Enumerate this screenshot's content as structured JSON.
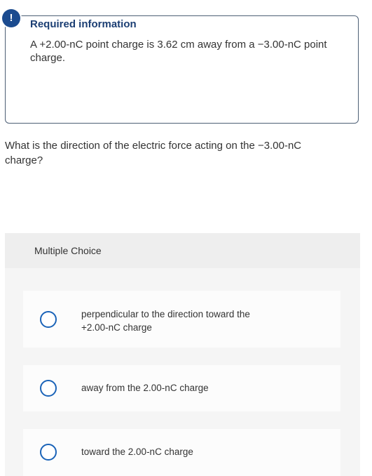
{
  "info": {
    "badge": "!",
    "title": "Required information",
    "body": "A +2.00-nC point charge is 3.62 cm away from a −3.00-nC point charge."
  },
  "question": {
    "text": "What is the direction of the electric force acting on the −3.00-nC charge?"
  },
  "multiple_choice": {
    "label": "Multiple Choice",
    "options": [
      {
        "label": "perpendicular to the direction toward the +2.00-nC charge",
        "selected": false
      },
      {
        "label": "away from the 2.00-nC charge",
        "selected": false
      },
      {
        "label": "toward the 2.00-nC charge",
        "selected": false
      }
    ]
  },
  "colors": {
    "accent": "#1b4b8f",
    "radio_border": "#1a63b8",
    "panel_bg": "#f5f5f5"
  }
}
